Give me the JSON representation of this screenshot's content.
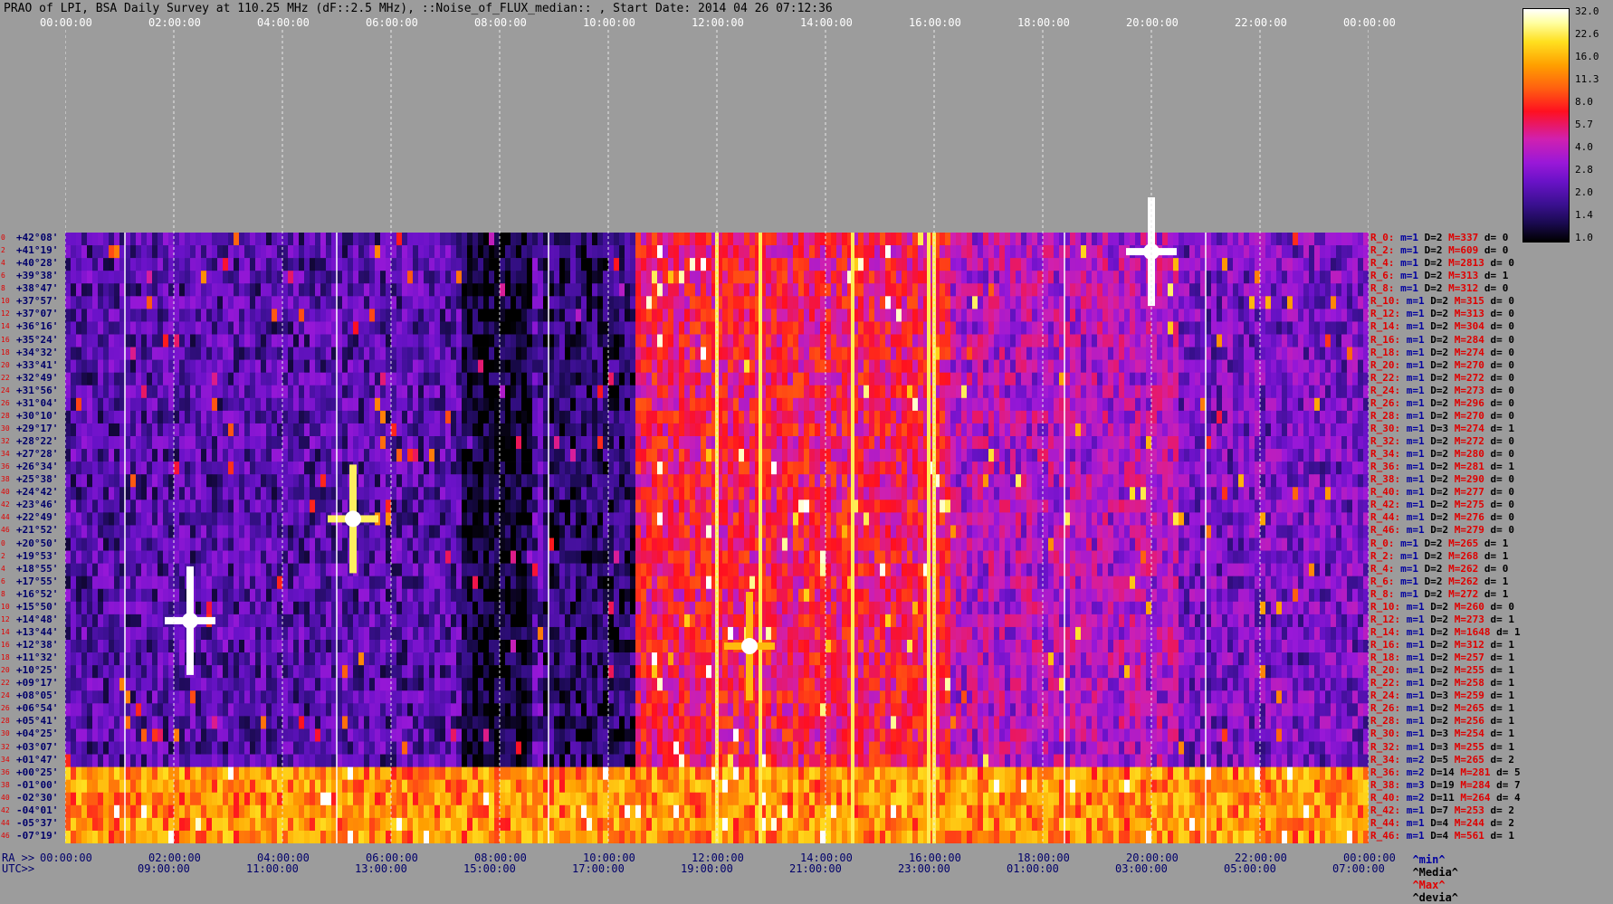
{
  "title": "PRAO of LPI, BSA Daily Survey at 110.25 MHz (dF::2.5 MHz), ::Noise_of_FLUX_median:: , Start Date: 2014 04 26 07:12:36",
  "top_times": [
    "00:00:00",
    "02:00:00",
    "04:00:00",
    "06:00:00",
    "08:00:00",
    "10:00:00",
    "12:00:00",
    "14:00:00",
    "16:00:00",
    "18:00:00",
    "20:00:00",
    "22:00:00",
    "00:00:00"
  ],
  "bottom_ra_prefix": "RA >>",
  "bottom_ra_times": [
    "00:00:00",
    "02:00:00",
    "04:00:00",
    "06:00:00",
    "08:00:00",
    "10:00:00",
    "12:00:00",
    "14:00:00",
    "16:00:00",
    "18:00:00",
    "20:00:00",
    "22:00:00",
    "00:00:00"
  ],
  "bottom_utc_prefix": "UTC>>",
  "bottom_utc_times": [
    "09:00:00",
    "11:00:00",
    "13:00:00",
    "15:00:00",
    "17:00:00",
    "19:00:00",
    "21:00:00",
    "23:00:00",
    "01:00:00",
    "03:00:00",
    "05:00:00",
    "07:00:00"
  ],
  "colorbar": {
    "ticks": [
      "32.0",
      "22.6",
      "16.0",
      "11.3",
      "8.0",
      "5.7",
      "4.0",
      "2.8",
      "2.0",
      "1.4",
      "1.0"
    ]
  },
  "legend": {
    "min": "^min^",
    "media": "^Media^",
    "max": "^Max^",
    "devia": "^devia^"
  },
  "chart_data": {
    "type": "heatmap",
    "title": "PRAO of LPI, BSA Daily Survey at 110.25 MHz (dF::2.5 MHz), ::Noise_of_FLUX_median:: , Start Date: 2014 04 26 07:12:36",
    "x_axis": "RA 00:00:00 - 24:00:00",
    "colorscale_range": [
      1.0,
      32.0
    ],
    "declinations": [
      "+42°08'",
      "+41°19'",
      "+40°28'",
      "+39°38'",
      "+38°47'",
      "+37°57'",
      "+37°07'",
      "+36°16'",
      "+35°24'",
      "+34°32'",
      "+33°41'",
      "+32°49'",
      "+31°56'",
      "+31°04'",
      "+30°10'",
      "+29°17'",
      "+28°22'",
      "+27°28'",
      "+26°34'",
      "+25°38'",
      "+24°42'",
      "+23°46'",
      "+22°49'",
      "+21°52'",
      "+20°50'",
      "+19°53'",
      "+18°55'",
      "+17°55'",
      "+16°52'",
      "+15°50'",
      "+14°48'",
      "+13°44'",
      "+12°38'",
      "+11°32'",
      "+10°25'",
      "+09°17'",
      "+08°05'",
      "+06°54'",
      "+05°41'",
      "+04°25'",
      "+03°07'",
      "+01°47'",
      "+00°25'",
      "-01°00'",
      "-02°30'",
      "-04°01'",
      "-05°37'",
      "-07°19'"
    ],
    "rows": [
      {
        "r": "R_0:",
        "m": "m=1",
        "d": "D=2",
        "max": "M=337",
        "dev": "d= 0"
      },
      {
        "r": "R_2:",
        "m": "m=1",
        "d": "D=2",
        "max": "M=609",
        "dev": "d= 0"
      },
      {
        "r": "R_4:",
        "m": "m=1",
        "d": "D=2",
        "max": "M=2813",
        "dev": "d= 0"
      },
      {
        "r": "R_6:",
        "m": "m=1",
        "d": "D=2",
        "max": "M=313",
        "dev": "d= 1"
      },
      {
        "r": "R_8:",
        "m": "m=1",
        "d": "D=2",
        "max": "M=312",
        "dev": "d= 0"
      },
      {
        "r": "R_10:",
        "m": "m=1",
        "d": "D=2",
        "max": "M=315",
        "dev": "d= 0"
      },
      {
        "r": "R_12:",
        "m": "m=1",
        "d": "D=2",
        "max": "M=313",
        "dev": "d= 0"
      },
      {
        "r": "R_14:",
        "m": "m=1",
        "d": "D=2",
        "max": "M=304",
        "dev": "d= 0"
      },
      {
        "r": "R_16:",
        "m": "m=1",
        "d": "D=2",
        "max": "M=284",
        "dev": "d= 0"
      },
      {
        "r": "R_18:",
        "m": "m=1",
        "d": "D=2",
        "max": "M=274",
        "dev": "d= 0"
      },
      {
        "r": "R_20:",
        "m": "m=1",
        "d": "D=2",
        "max": "M=270",
        "dev": "d= 0"
      },
      {
        "r": "R_22:",
        "m": "m=1",
        "d": "D=2",
        "max": "M=272",
        "dev": "d= 0"
      },
      {
        "r": "R_24:",
        "m": "m=1",
        "d": "D=2",
        "max": "M=273",
        "dev": "d= 0"
      },
      {
        "r": "R_26:",
        "m": "m=1",
        "d": "D=2",
        "max": "M=296",
        "dev": "d= 0"
      },
      {
        "r": "R_28:",
        "m": "m=1",
        "d": "D=2",
        "max": "M=270",
        "dev": "d= 0"
      },
      {
        "r": "R_30:",
        "m": "m=1",
        "d": "D=3",
        "max": "M=274",
        "dev": "d= 1"
      },
      {
        "r": "R_32:",
        "m": "m=1",
        "d": "D=2",
        "max": "M=272",
        "dev": "d= 0"
      },
      {
        "r": "R_34:",
        "m": "m=1",
        "d": "D=2",
        "max": "M=280",
        "dev": "d= 0"
      },
      {
        "r": "R_36:",
        "m": "m=1",
        "d": "D=2",
        "max": "M=281",
        "dev": "d= 1"
      },
      {
        "r": "R_38:",
        "m": "m=1",
        "d": "D=2",
        "max": "M=290",
        "dev": "d= 0"
      },
      {
        "r": "R_40:",
        "m": "m=1",
        "d": "D=2",
        "max": "M=277",
        "dev": "d= 0"
      },
      {
        "r": "R_42:",
        "m": "m=1",
        "d": "D=2",
        "max": "M=275",
        "dev": "d= 0"
      },
      {
        "r": "R_44:",
        "m": "m=1",
        "d": "D=2",
        "max": "M=276",
        "dev": "d= 0"
      },
      {
        "r": "R_46:",
        "m": "m=1",
        "d": "D=2",
        "max": "M=279",
        "dev": "d= 0"
      },
      {
        "r": "R_0:",
        "m": "m=1",
        "d": "D=2",
        "max": "M=265",
        "dev": "d= 1"
      },
      {
        "r": "R_2:",
        "m": "m=1",
        "d": "D=2",
        "max": "M=268",
        "dev": "d= 1"
      },
      {
        "r": "R_4:",
        "m": "m=1",
        "d": "D=2",
        "max": "M=262",
        "dev": "d= 0"
      },
      {
        "r": "R_6:",
        "m": "m=1",
        "d": "D=2",
        "max": "M=262",
        "dev": "d= 1"
      },
      {
        "r": "R_8:",
        "m": "m=1",
        "d": "D=2",
        "max": "M=272",
        "dev": "d= 1"
      },
      {
        "r": "R_10:",
        "m": "m=1",
        "d": "D=2",
        "max": "M=260",
        "dev": "d= 0"
      },
      {
        "r": "R_12:",
        "m": "m=1",
        "d": "D=2",
        "max": "M=273",
        "dev": "d= 1"
      },
      {
        "r": "R_14:",
        "m": "m=1",
        "d": "D=2",
        "max": "M=1648",
        "dev": "d= 1"
      },
      {
        "r": "R_16:",
        "m": "m=1",
        "d": "D=2",
        "max": "M=312",
        "dev": "d= 1"
      },
      {
        "r": "R_18:",
        "m": "m=1",
        "d": "D=2",
        "max": "M=257",
        "dev": "d= 1"
      },
      {
        "r": "R_20:",
        "m": "m=1",
        "d": "D=2",
        "max": "M=255",
        "dev": "d= 1"
      },
      {
        "r": "R_22:",
        "m": "m=1",
        "d": "D=2",
        "max": "M=258",
        "dev": "d= 1"
      },
      {
        "r": "R_24:",
        "m": "m=1",
        "d": "D=3",
        "max": "M=259",
        "dev": "d= 1"
      },
      {
        "r": "R_26:",
        "m": "m=1",
        "d": "D=2",
        "max": "M=265",
        "dev": "d= 1"
      },
      {
        "r": "R_28:",
        "m": "m=1",
        "d": "D=2",
        "max": "M=256",
        "dev": "d= 1"
      },
      {
        "r": "R_30:",
        "m": "m=1",
        "d": "D=3",
        "max": "M=254",
        "dev": "d= 1"
      },
      {
        "r": "R_32:",
        "m": "m=1",
        "d": "D=3",
        "max": "M=255",
        "dev": "d= 1"
      },
      {
        "r": "R_34:",
        "m": "m=2",
        "d": "D=5",
        "max": "M=265",
        "dev": "d= 2"
      },
      {
        "r": "R_36:",
        "m": "m=2",
        "d": "D=14",
        "max": "M=281",
        "dev": "d= 5"
      },
      {
        "r": "R_38:",
        "m": "m=3",
        "d": "D=19",
        "max": "M=284",
        "dev": "d= 7"
      },
      {
        "r": "R_40:",
        "m": "m=2",
        "d": "D=11",
        "max": "M=264",
        "dev": "d= 4"
      },
      {
        "r": "R_42:",
        "m": "m=1",
        "d": "D=7",
        "max": "M=253",
        "dev": "d= 2"
      },
      {
        "r": "R_44:",
        "m": "m=1",
        "d": "D=4",
        "max": "M=244",
        "dev": "d= 2"
      },
      {
        "r": "R_46:",
        "m": "m=1",
        "d": "D=4",
        "max": "M=561",
        "dev": "d= 1"
      }
    ],
    "row_index_labels": [
      "0",
      "2",
      "4",
      "6",
      "8",
      "10",
      "12",
      "14",
      "16",
      "18",
      "20",
      "22",
      "24",
      "26",
      "28",
      "30",
      "32",
      "34",
      "36",
      "38",
      "40",
      "42",
      "44",
      "46",
      "0",
      "2",
      "4",
      "6",
      "8",
      "10",
      "12",
      "14",
      "16",
      "18",
      "20",
      "22",
      "24",
      "26",
      "28",
      "30",
      "32",
      "34",
      "36",
      "38",
      "40",
      "42",
      "44",
      "46"
    ],
    "regions": [
      {
        "ra_from": 0.0,
        "ra_to": 9.8,
        "level": 2.2
      },
      {
        "ra_from": 7.3,
        "ra_to": 8.6,
        "level": 1.2
      },
      {
        "ra_from": 8.8,
        "ra_to": 10.5,
        "level": 1.6
      },
      {
        "ra_from": 10.5,
        "ra_to": 16.3,
        "level": 6.5
      },
      {
        "ra_from": 16.3,
        "ra_to": 20.5,
        "level": 4.0
      },
      {
        "ra_from": 20.5,
        "ra_to": 24.0,
        "level": 2.8
      }
    ],
    "band_rows": [
      42,
      47
    ],
    "band_level": 14.0,
    "bright_columns_ra": [
      12.0,
      12.8,
      14.5,
      15.9,
      16.0
    ],
    "point_sources": [
      {
        "ra": 20.0,
        "row": 1,
        "level": 32.0
      },
      {
        "ra": 2.3,
        "row": 30,
        "level": 32.0
      },
      {
        "ra": 5.3,
        "row": 22,
        "level": 22.6
      },
      {
        "ra": 12.6,
        "row": 32,
        "level": 16.0
      }
    ]
  }
}
